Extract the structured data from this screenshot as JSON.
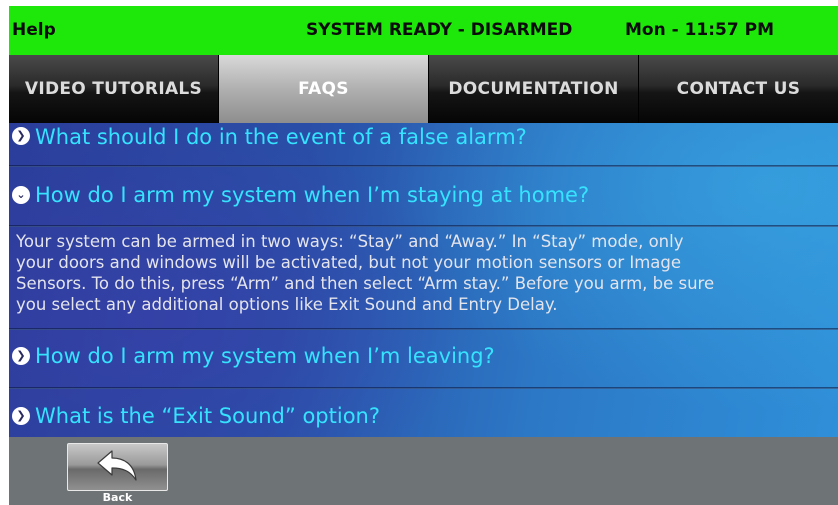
{
  "status_bar": {
    "title": "Help",
    "system_state": "SYSTEM READY - DISARMED",
    "clock": "Mon - 11:57 PM",
    "background_color": "#1ee80a"
  },
  "tabs": [
    {
      "label": "VIDEO TUTORIALS",
      "active": false
    },
    {
      "label": "FAQS",
      "active": true
    },
    {
      "label": "DOCUMENTATION",
      "active": false
    },
    {
      "label": "CONTACT US",
      "active": false
    }
  ],
  "faqs": [
    {
      "question": "What should I do in the event of a false alarm?",
      "expanded": false,
      "icon": "chevron-right-icon"
    },
    {
      "question": "How do I arm my system when I’m staying at home?",
      "expanded": true,
      "icon": "chevron-down-icon",
      "answer_lines": [
        "Your system can be armed in two ways: “Stay” and “Away.” In “Stay” mode, only",
        "your doors and windows will be activated, but not your motion sensors or Image",
        "Sensors. To do this, press “Arm” and then select “Arm stay.” Before you arm, be sure",
        "you select any additional options like Exit Sound and Entry Delay."
      ]
    },
    {
      "question": "How do I arm my system when I’m leaving?",
      "expanded": false,
      "icon": "chevron-right-icon"
    },
    {
      "question": "What is the “Exit Sound” option?",
      "expanded": false,
      "icon": "chevron-right-icon"
    }
  ],
  "footer": {
    "back_label": "Back",
    "back_icon": "back-arrow-icon"
  },
  "colors": {
    "question_text": "#36e3ff",
    "answer_text": "#e4e4ec",
    "footer_background": "#6e7476"
  }
}
